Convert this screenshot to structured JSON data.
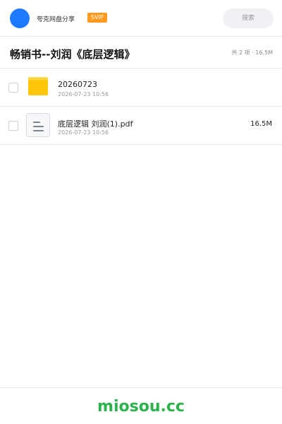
{
  "header": {
    "brand": "夸克网盘分享",
    "badge": "SVIP",
    "search_label": "搜索"
  },
  "share": {
    "title": "畅销书--刘润《底层逻辑》",
    "meta": "共 2 项 · 16.5M"
  },
  "files": [
    {
      "name": "20260723",
      "date": "2026-07-23 10:56",
      "size": "",
      "type": "folder-icon"
    },
    {
      "name": "底层逻辑 刘润(1).pdf",
      "date": "2026-07-23 10:56",
      "size": "16.5M",
      "type": "document-icon"
    }
  ],
  "footer": {
    "logo": "miosou.cc"
  },
  "colors": {
    "accent": "#1f7aff",
    "badge": "#ff9a1f",
    "folder": "#ffc60a",
    "footer_logo": "#2bb24c"
  }
}
